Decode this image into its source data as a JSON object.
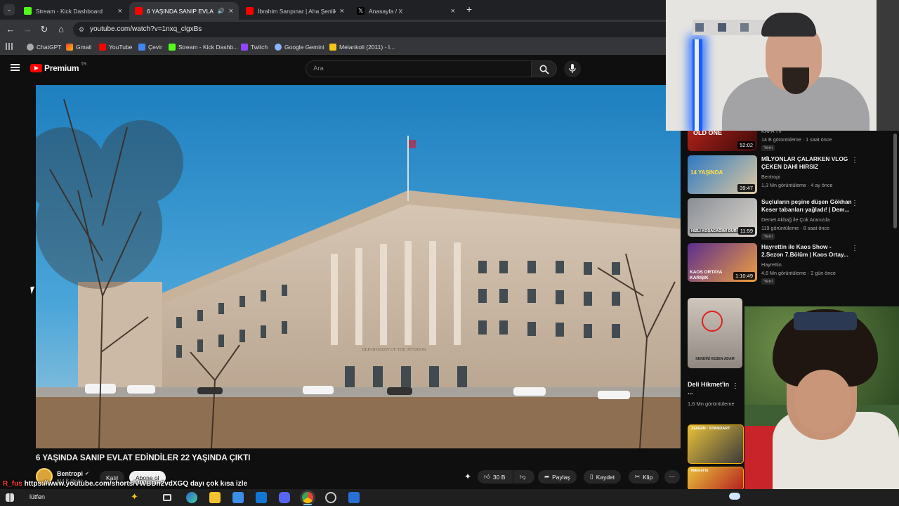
{
  "browser": {
    "tabs": [
      {
        "title": "Stream - Kick Dashboard",
        "active": false
      },
      {
        "title": "6 YAŞINDA SANIP EVLAT E",
        "active": true
      },
      {
        "title": "İbrahim Sarıpınar | Aha Şenlik",
        "active": false
      },
      {
        "title": "Anasayfa / X",
        "active": false
      }
    ],
    "url": "youtube.com/watch?v=1nxq_clgxBs",
    "bookmarks": [
      "ChatGPT",
      "Gmail",
      "YouTube",
      "Çevir",
      "Stream - Kick Dashb...",
      "Twitch",
      "Google Gemini",
      "Melankoli (2011) - I..."
    ]
  },
  "youtube": {
    "logo_text": "Premium",
    "logo_region": "TR",
    "search_placeholder": "Ara"
  },
  "video": {
    "title": "6 YAŞINDA SANIP EVLAT EDİNDİLER 22 YAŞINDA ÇIKTI",
    "sign_text": "DEPARTMENT OF THE INTERIOR",
    "channel": "Bentropi",
    "subscribers": "614 B abone",
    "join_label": "Katıl",
    "subscribe_label": "Abone ol",
    "like_count": "30 B",
    "share_label": "Paylaş",
    "save_label": "Kaydet",
    "clip_label": "Klip"
  },
  "sidebar": {
    "cards": [
      {
        "title": "",
        "channel": "KAFA TV",
        "meta": "14 B görüntüleme · 1 saat önce",
        "badge": "Yeni",
        "duration": "52:02",
        "thumb_text": "OLD ONE"
      },
      {
        "title": "MİLYONLAR ÇALARKEN VLOG ÇEKEN DAHİ HIRSIZ",
        "channel": "Bentropi",
        "meta": "1,3 Mn görüntüleme · 4 ay önce",
        "badge": "",
        "duration": "39:47",
        "thumb_text": "14 YAŞINDA"
      },
      {
        "title": "Suçluların peşine düşen Gökhan Keser tabanları yağladı! | Dem...",
        "channel": "Demet Akbağ ile Çok Aranızda",
        "meta": "119 görüntüleme · 8 saat önce",
        "badge": "Yeni",
        "duration": "11:59",
        "thumb_text": "HIZLI KOŞACAĞIM! DUR!"
      },
      {
        "title": "Hayrettin ile Kaos Show - 2.Sezon 7.Bölüm | Kaos Ortay...",
        "channel": "Hayrettin",
        "meta": "4,6 Mn görüntüleme · 2 gün önce",
        "badge": "Yeni",
        "duration": "1:10:49",
        "thumb_text": "KAOS ORTAYA KARIŞIK"
      }
    ],
    "short": {
      "title": "Deli Hikmet'in ...",
      "views": "1,6 Mn görüntüleme",
      "caption": "KENDİNİ KESEN ADAM"
    },
    "short_more": [
      {
        "thumb_text": "ZENGİN · STANDART"
      },
      {
        "thumb_text": "Hikmet'in"
      }
    ]
  },
  "overlay": {
    "chat_user": "R_fus",
    "chat_message": "https://www.youtube.com/shorts/VWBDh2vdXGQ dayı çok kısa izle",
    "taskbar_text": "lütfen"
  }
}
